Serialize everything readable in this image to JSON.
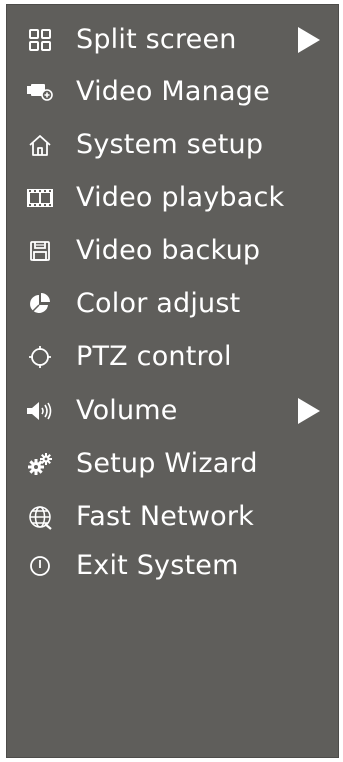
{
  "menu": {
    "background": "#5f5e5b",
    "text_color": "#ffffff",
    "items": [
      {
        "label": "Split screen",
        "icon": "grid-icon",
        "submenu": true
      },
      {
        "label": "Video Manage",
        "icon": "camera-icon",
        "submenu": false
      },
      {
        "label": "System setup",
        "icon": "home-icon",
        "submenu": false
      },
      {
        "label": "Video playback",
        "icon": "film-icon",
        "submenu": false
      },
      {
        "label": "Video backup",
        "icon": "floppy-icon",
        "submenu": false
      },
      {
        "label": "Color adjust",
        "icon": "pie-icon",
        "submenu": false
      },
      {
        "label": "PTZ control",
        "icon": "crosshair-icon",
        "submenu": false
      },
      {
        "label": "Volume",
        "icon": "speaker-icon",
        "submenu": true
      },
      {
        "label": "Setup Wizard",
        "icon": "gears-icon",
        "submenu": false
      },
      {
        "label": "Fast Network",
        "icon": "globe-icon",
        "submenu": false
      },
      {
        "label": "Exit System",
        "icon": "power-icon",
        "submenu": false
      }
    ]
  }
}
